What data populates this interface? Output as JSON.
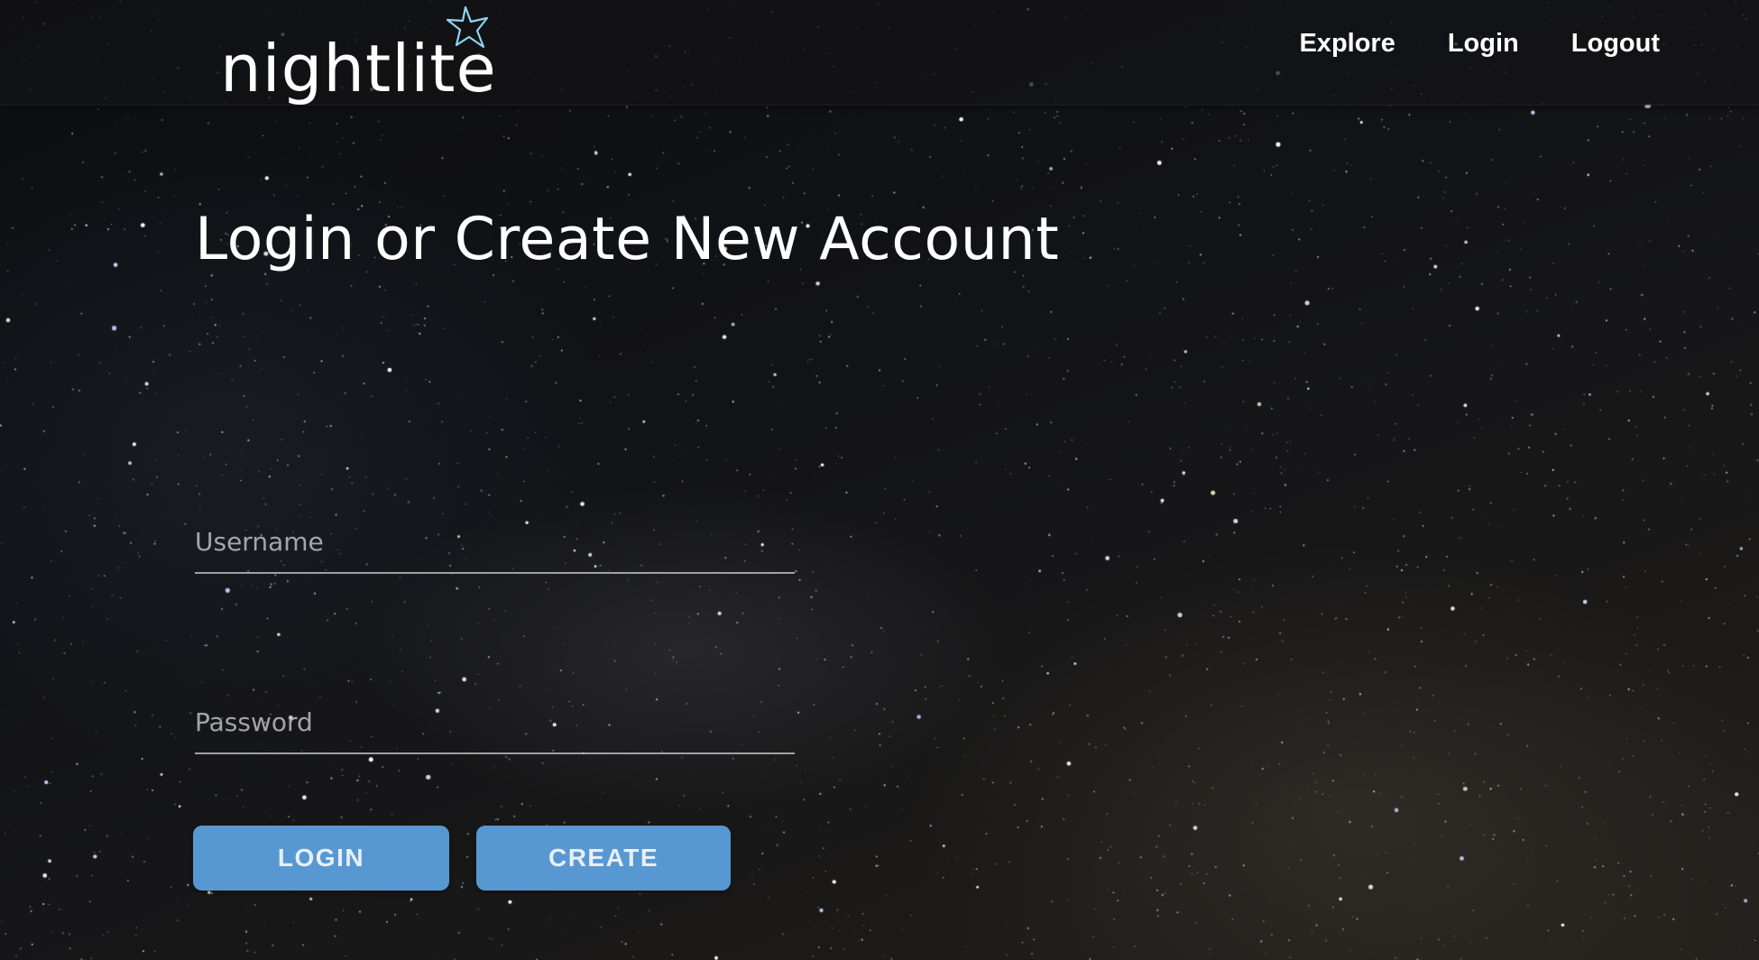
{
  "header": {
    "logo_text": "nightlite",
    "nav": [
      {
        "label": "Explore"
      },
      {
        "label": "Login"
      },
      {
        "label": "Logout"
      }
    ]
  },
  "main": {
    "title": "Login or Create New Account",
    "form": {
      "username": {
        "placeholder": "Username",
        "value": ""
      },
      "password": {
        "placeholder": "Password",
        "value": ""
      },
      "login_label": "LOGIN",
      "create_label": "CREATE"
    }
  },
  "colors": {
    "button_bg": "#5898d2",
    "star_outline": "#8fd3ee",
    "background": "#121317"
  },
  "icons": {
    "logo_star": "star-outline-icon"
  }
}
